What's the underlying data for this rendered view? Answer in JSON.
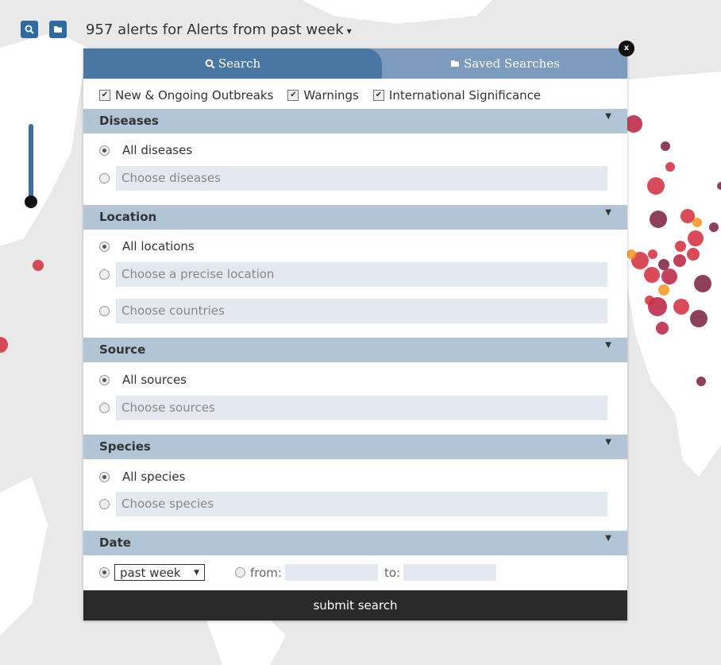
{
  "header": {
    "alerts_text": "957 alerts for Alerts from past week",
    "caret": "▾"
  },
  "tabs": [
    {
      "label": "Search",
      "icon": "search-icon"
    },
    {
      "label": "Saved Searches",
      "icon": "folder-icon"
    }
  ],
  "close_label": "x",
  "filters": [
    {
      "label": "New & Ongoing Outbreaks",
      "checked": true
    },
    {
      "label": "Warnings",
      "checked": true
    },
    {
      "label": "International Significance",
      "checked": true
    }
  ],
  "sections": {
    "diseases": {
      "title": "Diseases",
      "all": "All diseases",
      "choose": "Choose diseases"
    },
    "location": {
      "title": "Location",
      "all": "All locations",
      "precise": "Choose a precise location",
      "countries": "Choose countries"
    },
    "source": {
      "title": "Source",
      "all": "All sources",
      "choose": "Choose sources"
    },
    "species": {
      "title": "Species",
      "all": "All species",
      "choose": "Choose species"
    },
    "date": {
      "title": "Date",
      "selected": "past week",
      "from": "from:",
      "to": "to:"
    }
  },
  "submit_label": "submit search",
  "colors": {
    "accent": "#4a76a4",
    "tab_inactive": "#7d9bbd",
    "section_header": "#b2c5d6",
    "submit_bg": "#2a2a2a",
    "marker_red": "#d22b3c",
    "marker_dark": "#7a1f3d",
    "marker_orange": "#f7941d"
  }
}
